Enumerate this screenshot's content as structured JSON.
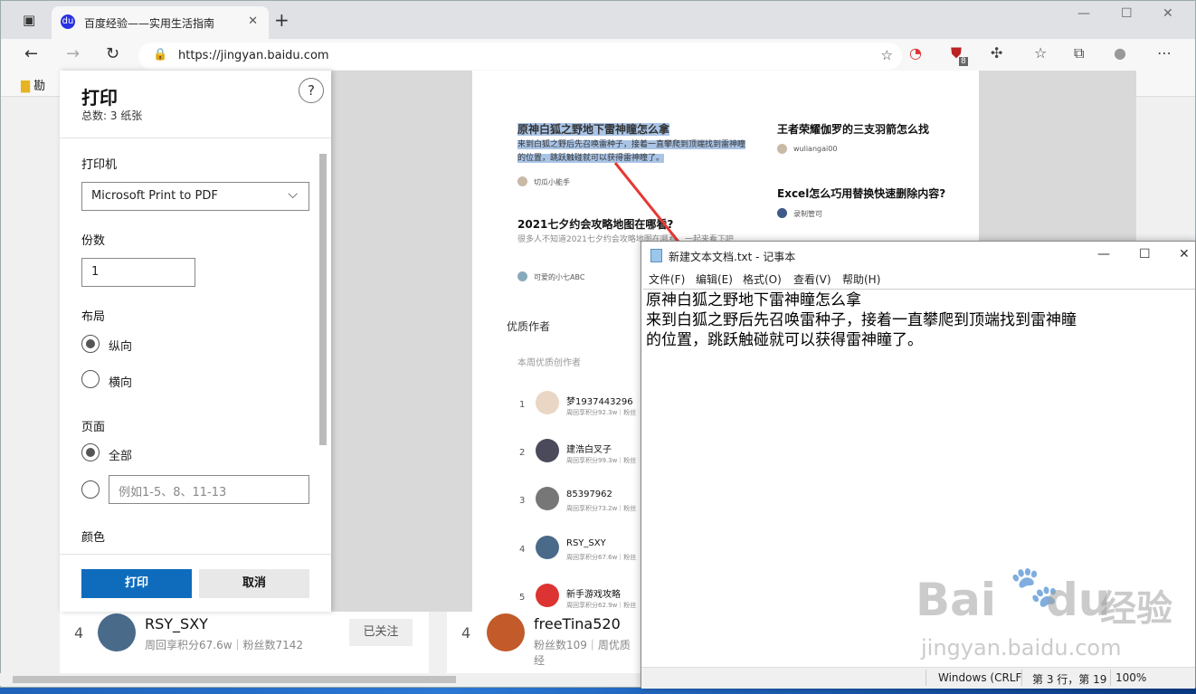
{
  "browser": {
    "tab_title": "百度经验——实用生活指南",
    "url": "https://jingyan.baidu.com",
    "bookmark_folder": "勘",
    "extension_badge": "8",
    "favicon_glyph": "du"
  },
  "print": {
    "title": "打印",
    "total": "总数: 3 纸张",
    "printer_label": "打印机",
    "printer_value": "Microsoft Print to PDF",
    "copies_label": "份数",
    "copies_value": "1",
    "layout_label": "布局",
    "portrait": "纵向",
    "landscape": "横向",
    "pages_label": "页面",
    "all_pages": "全部",
    "range_placeholder": "例如1-5、8、11-13",
    "color_label": "颜色",
    "print_button": "打印",
    "cancel_button": "取消",
    "primary_color": "#0f6cbd"
  },
  "preview": {
    "article1_title": "原神白狐之野地下雷神瞳怎么拿",
    "article1_desc_line1": "来到白狐之野后先召唤雷种子，接着一直攀爬到顶端找到雷神瞳",
    "article1_desc_line2": "的位置，跳跃触碰就可以获得雷神瞳了。",
    "article1_author": "切瓜小能手",
    "article2_title": "王者荣耀伽罗的三支羽箭怎么找",
    "article2_author": "wuliangai00",
    "article3_title": "Excel怎么巧用替换快速删除内容?",
    "article3_author": "录制管可",
    "article4_title": "2021七夕约会攻略地图在哪看?",
    "article4_desc": "很多人不知道2021七夕约会攻略地图在哪看，一起来看下吧",
    "article4_author": "可爱的小七ABC",
    "section": "优质作者",
    "subsection": "本周优质创作者",
    "ranking": [
      {
        "rank": "1",
        "name": "梦1937443296",
        "stat": "周回享积分92.3w｜粉丝"
      },
      {
        "rank": "2",
        "name": "建浩白叉子",
        "stat": "周回享积分99.3w｜粉丝"
      },
      {
        "rank": "3",
        "name": "85397962",
        "stat": "周回享积分73.2w｜粉丝"
      },
      {
        "rank": "4",
        "name": "RSY_SXY",
        "stat": "周回享积分67.6w｜粉丝"
      },
      {
        "rank": "5",
        "name": "新手游戏攻略",
        "stat": "周回享积分62.9w｜粉丝"
      }
    ]
  },
  "notepad": {
    "title": "新建文本文档.txt - 记事本",
    "menu": [
      "文件(F)",
      "编辑(E)",
      "格式(O)",
      "查看(V)",
      "帮助(H)"
    ],
    "text": "原神白狐之野地下雷神瞳怎么拿\n来到白狐之野后先召唤雷种子，接着一直攀爬到顶端找到雷神瞳\n的位置，跳跃触碰就可以获得雷神瞳了。",
    "status_encoding": "Windows (CRLF",
    "status_position": "第 3 行，第 19",
    "status_zoom": "100%"
  },
  "background_row": {
    "left_rank": "4",
    "left_name": "RSY_SXY",
    "left_stat": "周回享积分67.6w｜粉丝数7142",
    "left_button": "已关注",
    "right_rank": "4",
    "right_name": "freeTina520",
    "right_stat": "粉丝数109｜周优质经"
  },
  "watermark": {
    "brand": "Bai",
    "brand2": "du",
    "cn": "经验",
    "url": "jingyan.baidu.com"
  },
  "arrow_color": "#e53935",
  "icons": [
    "tab-actions-icon",
    "baidu-favicon",
    "close-icon",
    "new-tab-icon",
    "minimize-icon",
    "maximize-icon",
    "back-icon",
    "forward-icon",
    "refresh-icon",
    "lock-icon",
    "favorite-add-icon",
    "extension-icon",
    "favorites-icon",
    "collections-icon",
    "profile-icon",
    "more-icon",
    "folder-icon",
    "help-icon",
    "chevron-down-icon",
    "notepad-icon"
  ]
}
